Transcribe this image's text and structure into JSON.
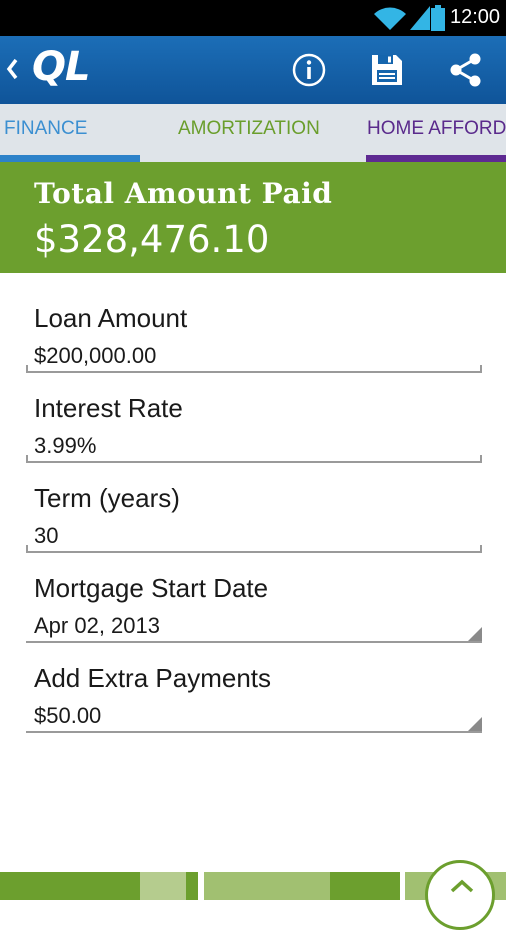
{
  "status_bar": {
    "time": "12:00"
  },
  "app_bar": {
    "logo": "QL"
  },
  "tabs": [
    {
      "label": "FINANCE"
    },
    {
      "label": "AMORTIZATION"
    },
    {
      "label": "HOME AFFORD"
    }
  ],
  "summary": {
    "title": "Total Amount Paid",
    "value": "$328,476.10"
  },
  "fields": [
    {
      "label": "Loan Amount",
      "value": "$200,000.00"
    },
    {
      "label": "Interest Rate",
      "value": "3.99%"
    },
    {
      "label": "Term (years)",
      "value": "30"
    },
    {
      "label": "Mortgage Start Date",
      "value": "Apr 02, 2013"
    },
    {
      "label": "Add Extra Payments",
      "value": "$50.00"
    }
  ],
  "colors": {
    "action_bar": "#1565ad",
    "accent_green": "#6c9f2e",
    "tab_blue": "#2d82c9",
    "tab_purple": "#5e2a92"
  },
  "icons": [
    "wifi-icon",
    "signal-icon",
    "battery-icon",
    "back-chevron-icon",
    "info-icon",
    "save-icon",
    "share-icon",
    "chevron-up-icon"
  ]
}
